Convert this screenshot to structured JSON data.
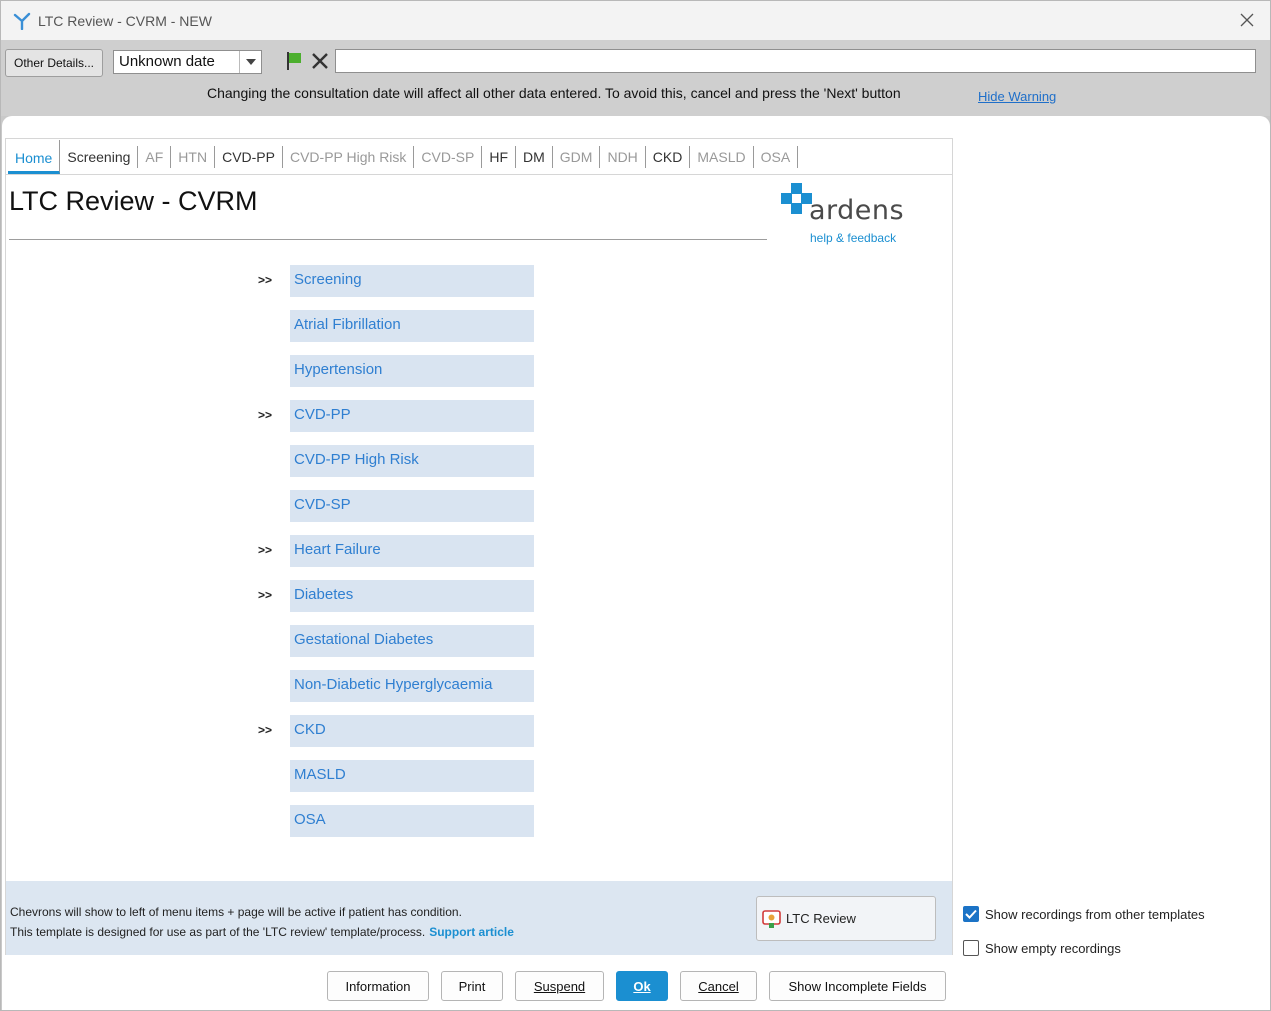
{
  "window": {
    "title": "LTC Review - CVRM - NEW"
  },
  "toolbar": {
    "other_details_label": "Other Details...",
    "date_value": "Unknown date",
    "warning_text": "Changing the consultation date will affect all other data entered. To avoid this, cancel and press the 'Next' button",
    "hide_warning_label": "Hide Warning"
  },
  "tabs": [
    {
      "label": "Home",
      "state": "active"
    },
    {
      "label": "Screening",
      "state": "enabled"
    },
    {
      "label": "AF",
      "state": "disabled"
    },
    {
      "label": "HTN",
      "state": "disabled"
    },
    {
      "label": "CVD-PP",
      "state": "enabled"
    },
    {
      "label": "CVD-PP High Risk",
      "state": "disabled"
    },
    {
      "label": "CVD-SP",
      "state": "disabled"
    },
    {
      "label": "HF",
      "state": "enabled"
    },
    {
      "label": "DM",
      "state": "enabled"
    },
    {
      "label": "GDM",
      "state": "disabled"
    },
    {
      "label": "NDH",
      "state": "disabled"
    },
    {
      "label": "CKD",
      "state": "enabled"
    },
    {
      "label": "MASLD",
      "state": "disabled"
    },
    {
      "label": "OSA",
      "state": "disabled"
    }
  ],
  "page": {
    "title": "LTC Review - CVRM"
  },
  "brand": {
    "name": "ardens",
    "help_link": "help & feedback",
    "colors": {
      "cross": "#1b8fd1",
      "text": "#4a4a4a"
    }
  },
  "menu": {
    "chevron": ">>",
    "items": [
      {
        "label": "Screening",
        "chevron": true
      },
      {
        "label": "Atrial Fibrillation",
        "chevron": false
      },
      {
        "label": "Hypertension",
        "chevron": false
      },
      {
        "label": "CVD-PP",
        "chevron": true
      },
      {
        "label": "CVD-PP High Risk",
        "chevron": false
      },
      {
        "label": "CVD-SP",
        "chevron": false
      },
      {
        "label": "Heart Failure",
        "chevron": true
      },
      {
        "label": "Diabetes",
        "chevron": true
      },
      {
        "label": "Gestational Diabetes",
        "chevron": false
      },
      {
        "label": "Non-Diabetic Hyperglycaemia",
        "chevron": false
      },
      {
        "label": "CKD",
        "chevron": true
      },
      {
        "label": "MASLD",
        "chevron": false
      },
      {
        "label": "OSA",
        "chevron": false
      }
    ]
  },
  "footer": {
    "info_line1": "Chevrons will show to left of menu items + page will be active if patient has condition.",
    "info_line2": "This template is designed for use as part of the 'LTC review' template/process.",
    "support_link": "Support article",
    "ltc_button": "LTC Review"
  },
  "options": {
    "show_recordings_label": "Show recordings from other templates",
    "show_recordings_checked": true,
    "show_empty_label": "Show empty recordings",
    "show_empty_checked": false
  },
  "buttons": {
    "information": "Information",
    "print": "Print",
    "suspend": "Suspend",
    "ok": "Ok",
    "cancel": "Cancel",
    "show_incomplete": "Show Incomplete Fields"
  }
}
